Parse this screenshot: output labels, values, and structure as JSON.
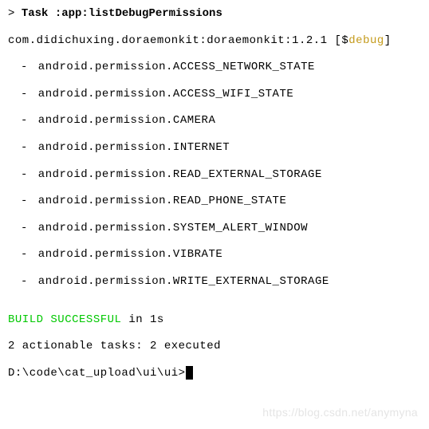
{
  "task": {
    "chevron": ">",
    "label": "Task",
    "name": ":app:listDebugPermissions"
  },
  "module": {
    "identifier": "com.didichuxing.doraemonkit:doraemonkit:1.2.1",
    "tag_prefix": " [$",
    "tag_debug": "debug",
    "tag_suffix": "]"
  },
  "permissions": [
    "android.permission.ACCESS_NETWORK_STATE",
    "android.permission.ACCESS_WIFI_STATE",
    "android.permission.CAMERA",
    "android.permission.INTERNET",
    "android.permission.READ_EXTERNAL_STORAGE",
    "android.permission.READ_PHONE_STATE",
    "android.permission.SYSTEM_ALERT_WINDOW",
    "android.permission.VIBRATE",
    "android.permission.WRITE_EXTERNAL_STORAGE"
  ],
  "build": {
    "status": "BUILD SUCCESSFUL",
    "duration": " in 1s"
  },
  "tasks_info": "2 actionable tasks: 2 executed",
  "prompt": "D:\\code\\cat_upload\\ui\\ui>",
  "watermark": "https://blog.csdn.net/anymyna"
}
